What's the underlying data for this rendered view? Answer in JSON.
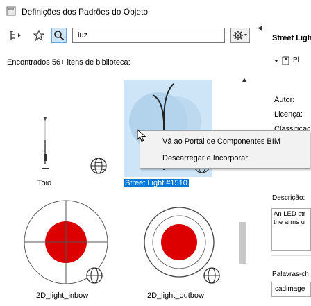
{
  "window": {
    "title": "Definições dos Padrões do Objeto"
  },
  "toolbar": {
    "search_value": "luz",
    "icons": [
      "hierarchy-icon",
      "star-icon",
      "search-icon",
      "settings-icon"
    ]
  },
  "results": {
    "found_text": "Encontrados 56+ itens de biblioteca:"
  },
  "items": [
    {
      "label": "Toio"
    },
    {
      "label": "Street Light #1510"
    },
    {
      "label": "2D_light_inbow"
    },
    {
      "label": "2D_light_outbow"
    }
  ],
  "context_menu": {
    "items": [
      "Vá ao Portal de Componentes BIM",
      "Descarregar e Incorporar"
    ]
  },
  "details": {
    "title": "Street Ligh",
    "author_label": "Autor:",
    "license_label": "Licença:",
    "classification_label": "Classificaç",
    "description_label": "Descrição:",
    "description_text": "An LED str\nthe arms u",
    "keywords_label": "Palavras-ch",
    "keywords_value": "cadimage",
    "dropdown_value": "Pl"
  },
  "colors": {
    "accent": "#0078d7",
    "red": "#dd0000"
  }
}
